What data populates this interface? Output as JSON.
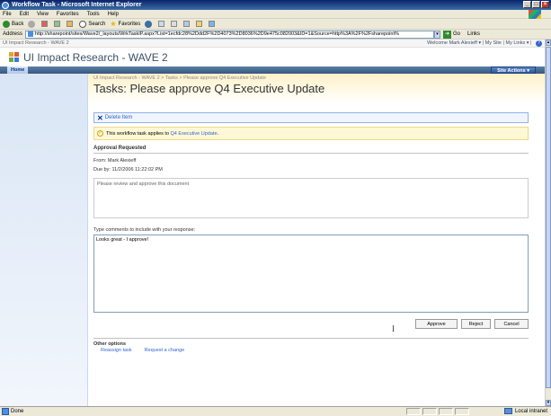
{
  "window": {
    "title": "Workflow Task - Microsoft Internet Explorer"
  },
  "menu": [
    "File",
    "Edit",
    "View",
    "Favorites",
    "Tools",
    "Help"
  ],
  "toolbar": {
    "back": "Back",
    "search": "Search",
    "favorites": "Favorites"
  },
  "address": {
    "label": "Address",
    "url": "http://sharepoint/sites/Wave2/_layouts/WrkTaskIP.aspx?List=1ecfdc28%2Ddd2F%2D4073%2D8036%2D9e475c082003&ID=1&Source=http%3A%2F%2Fsharepoint%",
    "go": "Go",
    "links": "Links"
  },
  "sp": {
    "top_left": "UI Impact Research - WAVE 2",
    "welcome": "Welcome Mark Alexieff ▾",
    "my_site": "My Site",
    "my_links": "My Links ▾",
    "site_title": "UI Impact Research - WAVE 2",
    "home_tab": "Home",
    "site_actions": "Site Actions ▾"
  },
  "page": {
    "breadcrumb": "UI Impact Research - WAVE 2 > Tasks > Please approve Q4 Executive Update",
    "title": "Tasks: Please approve Q4 Executive Update",
    "delete_item": "Delete Item",
    "notice_prefix": "This workflow task applies to ",
    "notice_link": "Q4 Executive Update",
    "notice_suffix": ".",
    "section_title": "Approval Requested",
    "from": "From: Mark Alexieff",
    "due_by": "Due by: 11/2/2006  11:22:02 PM",
    "description": "Please review and approve this document",
    "comments_label": "Type comments to include with your response:",
    "comments_value": "Looks great - I approve!",
    "approve": "Approve",
    "reject": "Reject",
    "cancel": "Cancel",
    "other_options": "Other options",
    "reassign": "Reassign task",
    "request_change": "Request a change"
  },
  "status": {
    "left": "Done",
    "zone": "Local intranet"
  },
  "colors": {
    "title_bar": "#0a246a",
    "nav_bar": "#37587f",
    "title_area": "#fff1c8",
    "link": "#3366cc"
  }
}
